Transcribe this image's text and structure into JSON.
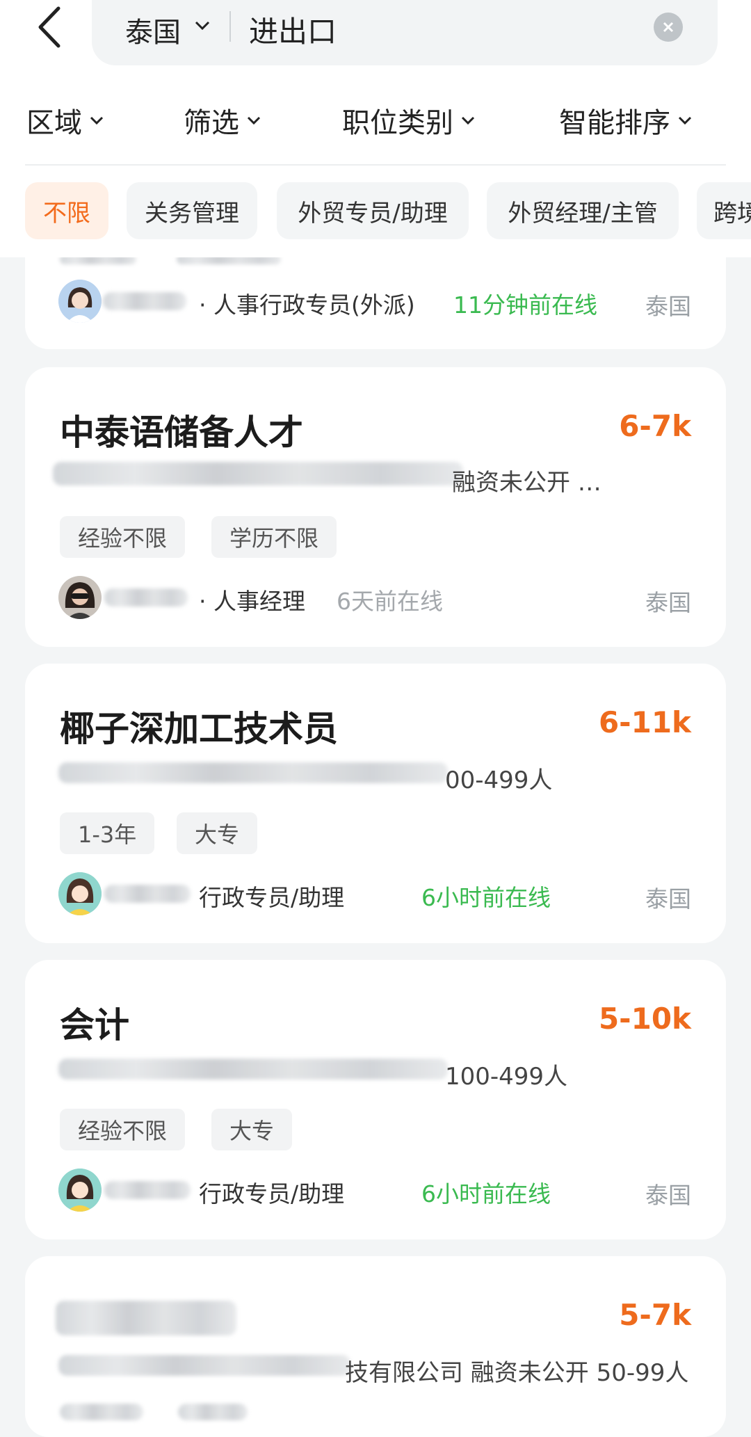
{
  "search": {
    "city": "泰国",
    "query": "进出口"
  },
  "filters": [
    "区域",
    "筛选",
    "职位类别",
    "智能排序"
  ],
  "chips": [
    "不限",
    "关务管理",
    "外贸专员/助理",
    "外贸经理/主管",
    "跨境"
  ],
  "partial_card": {
    "recruiter": "· 人事行政专员(外派)",
    "online": "11分钟前在线",
    "location": "泰国"
  },
  "jobs": [
    {
      "title": "中泰语储备人才",
      "salary": "6-7k",
      "company_tail": "融资未公开 …",
      "tags": [
        "经验不限",
        "学历不限"
      ],
      "recruiter": "· 人事经理",
      "online": "6天前在线",
      "location": "泰国"
    },
    {
      "title": "椰子深加工技术员",
      "salary": "6-11k",
      "company_tail": "00-499人",
      "tags": [
        "1-3年",
        "大专"
      ],
      "recruiter": "行政专员/助理",
      "online": "6小时前在线",
      "location": "泰国"
    },
    {
      "title": "会计",
      "salary": "5-10k",
      "company_tail": "100-499人",
      "tags": [
        "经验不限",
        "大专"
      ],
      "recruiter": "行政专员/助理",
      "online": "6小时前在线",
      "location": "泰国"
    },
    {
      "title": "",
      "salary": "5-7k",
      "company_tail": "技有限公司 融资未公开 50-99人"
    }
  ],
  "colors": {
    "accent": "#ee6b1d",
    "online": "#3aba50",
    "background": "#f3f5f6"
  }
}
